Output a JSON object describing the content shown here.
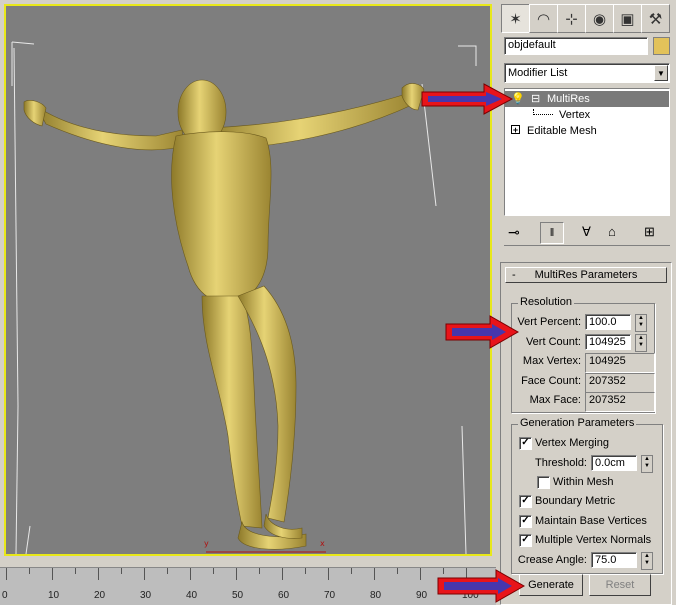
{
  "object_name": "objdefault",
  "object_color": "#e2c25a",
  "modifier_list": {
    "label": "Modifier List"
  },
  "stack": [
    {
      "label": "MultiRes",
      "toggle": "⊟",
      "selected": true
    },
    {
      "label": "Vertex",
      "sub": true
    },
    {
      "label": "Editable Mesh",
      "toggle": "+"
    }
  ],
  "rollout": {
    "title": "MultiRes Parameters",
    "collapse": "-",
    "resolution": {
      "title": "Resolution",
      "vert_percent": {
        "label": "Vert Percent:",
        "value": "100.0"
      },
      "vert_count": {
        "label": "Vert Count:",
        "value": "104925"
      },
      "max_vertex": {
        "label": "Max Vertex:",
        "value": "104925"
      },
      "face_count": {
        "label": "Face Count:",
        "value": "207352"
      },
      "max_face": {
        "label": "Max Face:",
        "value": "207352"
      }
    },
    "generation": {
      "title": "Generation Parameters",
      "vertex_merging": {
        "label": "Vertex Merging",
        "checked": true
      },
      "threshold": {
        "label": "Threshold:",
        "value": "0.0cm"
      },
      "within_mesh": {
        "label": "Within Mesh",
        "checked": false
      },
      "boundary_metric": {
        "label": "Boundary Metric",
        "checked": true
      },
      "maintain_base": {
        "label": "Maintain Base Vertices",
        "checked": true
      },
      "multiple_normals": {
        "label": "Multiple Vertex Normals",
        "checked": true
      },
      "crease_angle": {
        "label": "Crease Angle:",
        "value": "75.0"
      }
    },
    "generate_label": "Generate",
    "reset_label": "Reset"
  },
  "ruler_labels": [
    "0",
    "10",
    "20",
    "30",
    "40",
    "50",
    "60",
    "70",
    "80",
    "90",
    "100"
  ],
  "colors": {
    "viewport_bg": "#7e7e7e",
    "viewport_border": "#e8e81a",
    "model": "#d7c25d",
    "arrow": "#e8141a"
  }
}
